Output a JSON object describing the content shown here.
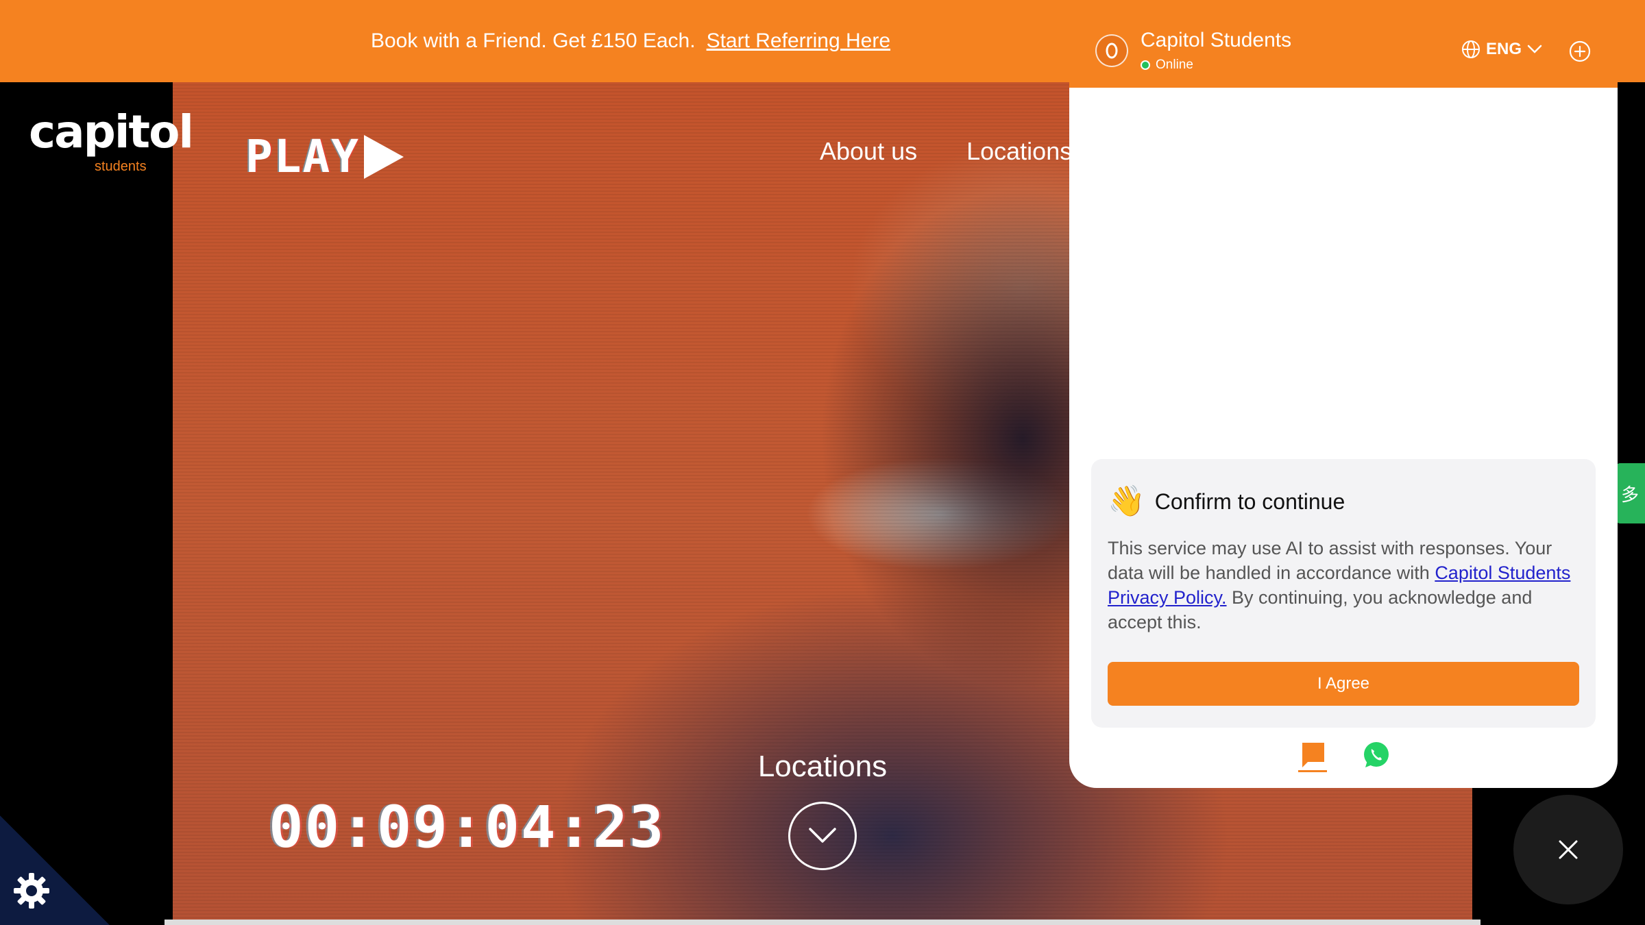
{
  "promo": {
    "text": "Book with a Friend. Get £150 Each.",
    "link_label": "Start Referring Here"
  },
  "brand": {
    "logo_text": "capitol",
    "logo_subtext": "students",
    "play_text": "PLAY"
  },
  "nav": {
    "items": [
      "About us",
      "Locations"
    ]
  },
  "hero": {
    "timecode": "00:09:04:23",
    "cta_label": "Locations"
  },
  "side_tab": {
    "label": "多"
  },
  "chat": {
    "title": "Capitol Students",
    "status": "Online",
    "language": "ENG",
    "consent": {
      "title": "Confirm to continue",
      "body_before_link": "This service may use AI to assist with responses. Your data will be handled in accordance with ",
      "link_label": "Capitol Students Privacy Policy.",
      "body_after_link": " By continuing, you acknowledge and accept this.",
      "button_label": "I Agree"
    }
  },
  "colors": {
    "brand_orange": "#f58220",
    "online_green": "#25c05b",
    "whatsapp_green": "#25d366",
    "side_tab_green": "#27b35a",
    "link_blue": "#2222cc"
  },
  "icons": [
    "globe-icon",
    "chevron-down-icon",
    "plus-circle-icon",
    "chat-bubble-icon",
    "whatsapp-icon",
    "close-icon",
    "gear-icon",
    "wave-hand-icon"
  ]
}
